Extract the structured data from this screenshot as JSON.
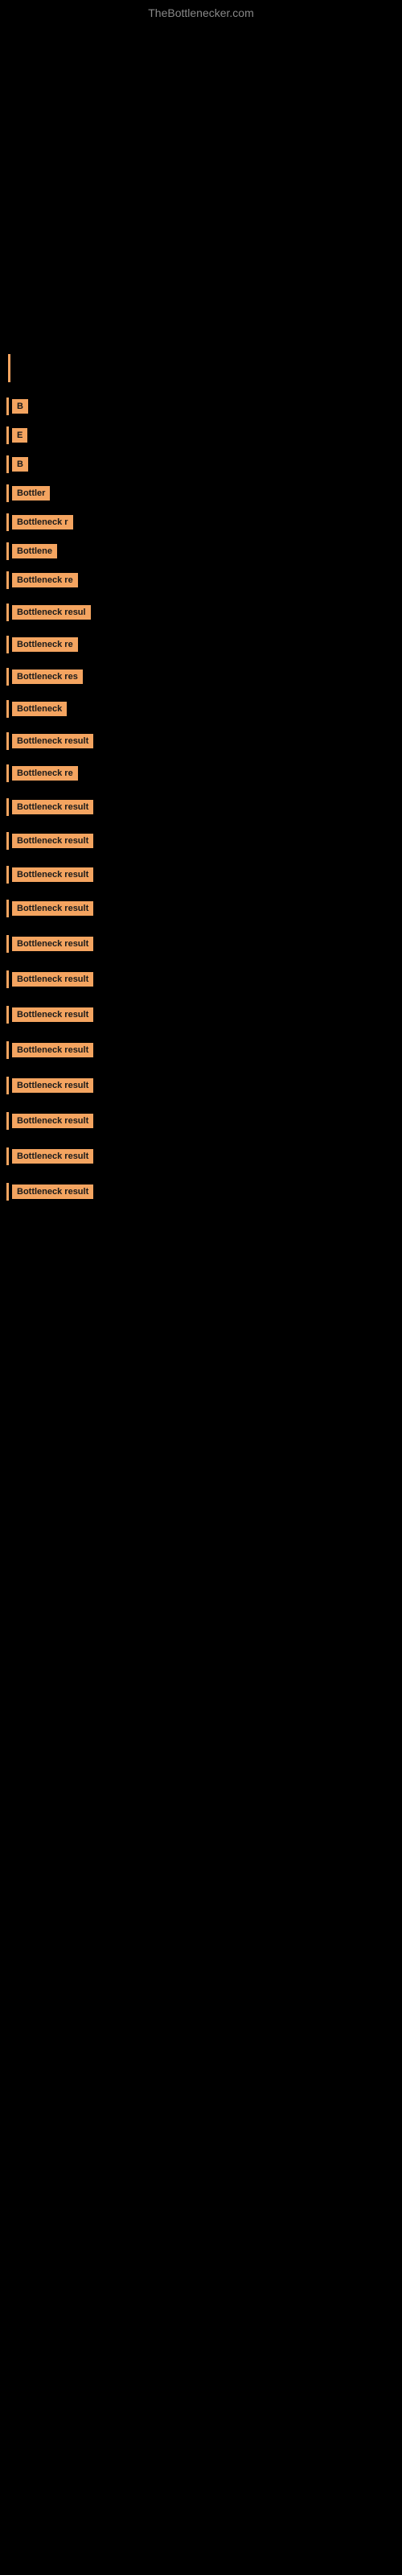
{
  "site": {
    "title": "TheBottlenecker.com"
  },
  "rows": [
    {
      "id": 1,
      "label": "B",
      "size": "xs"
    },
    {
      "id": 2,
      "label": "E",
      "size": "xs"
    },
    {
      "id": 3,
      "label": "B",
      "size": "xs"
    },
    {
      "id": 4,
      "label": "Bottler",
      "size": "sm"
    },
    {
      "id": 5,
      "label": "Bottleneck r",
      "size": "md"
    },
    {
      "id": 6,
      "label": "Bottlene",
      "size": "sm2"
    },
    {
      "id": 7,
      "label": "Bottleneck re",
      "size": "md2"
    },
    {
      "id": 8,
      "label": "Bottleneck resul",
      "size": "lg"
    },
    {
      "id": 9,
      "label": "Bottleneck re",
      "size": "md2"
    },
    {
      "id": 10,
      "label": "Bottleneck res",
      "size": "md3"
    },
    {
      "id": 11,
      "label": "Bottleneck",
      "size": "md"
    },
    {
      "id": 12,
      "label": "Bottleneck result",
      "size": "full"
    },
    {
      "id": 13,
      "label": "Bottleneck re",
      "size": "md2"
    },
    {
      "id": 14,
      "label": "Bottleneck result",
      "size": "full"
    },
    {
      "id": 15,
      "label": "Bottleneck result",
      "size": "full"
    },
    {
      "id": 16,
      "label": "Bottleneck result",
      "size": "full"
    },
    {
      "id": 17,
      "label": "Bottleneck result",
      "size": "full"
    },
    {
      "id": 18,
      "label": "Bottleneck result",
      "size": "full"
    },
    {
      "id": 19,
      "label": "Bottleneck result",
      "size": "full"
    },
    {
      "id": 20,
      "label": "Bottleneck result",
      "size": "full"
    },
    {
      "id": 21,
      "label": "Bottleneck result",
      "size": "full"
    },
    {
      "id": 22,
      "label": "Bottleneck result",
      "size": "full"
    },
    {
      "id": 23,
      "label": "Bottleneck result",
      "size": "full"
    },
    {
      "id": 24,
      "label": "Bottleneck result",
      "size": "full"
    },
    {
      "id": 25,
      "label": "Bottleneck result",
      "size": "full"
    }
  ]
}
